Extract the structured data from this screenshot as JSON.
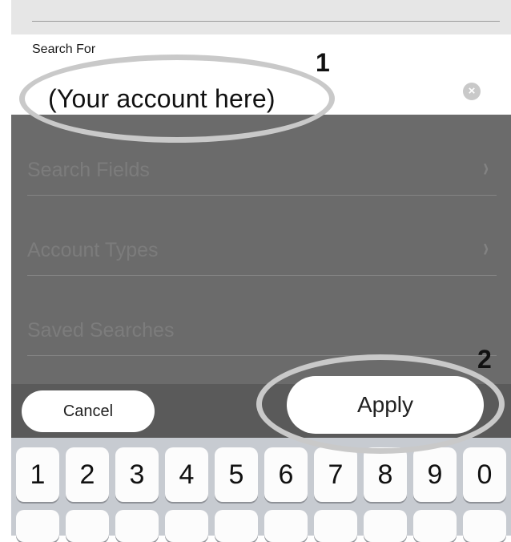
{
  "search": {
    "label": "Search For",
    "value": "(Your account here)",
    "clear_icon": "×"
  },
  "menu": {
    "items": [
      {
        "label": "Search Fields",
        "chevron": "›"
      },
      {
        "label": "Account Types",
        "chevron": "›"
      },
      {
        "label": "Saved Searches"
      }
    ]
  },
  "toolbar": {
    "cancel_label": "Cancel",
    "apply_label": "Apply"
  },
  "keyboard": {
    "row1": [
      "1",
      "2",
      "3",
      "4",
      "5",
      "6",
      "7",
      "8",
      "9",
      "0"
    ]
  },
  "annotations": [
    "1",
    "2"
  ],
  "colors": {
    "overlay": "#6b6b6b",
    "highlight": "#c9c9c9",
    "keyboard": "#c7cbd1"
  }
}
